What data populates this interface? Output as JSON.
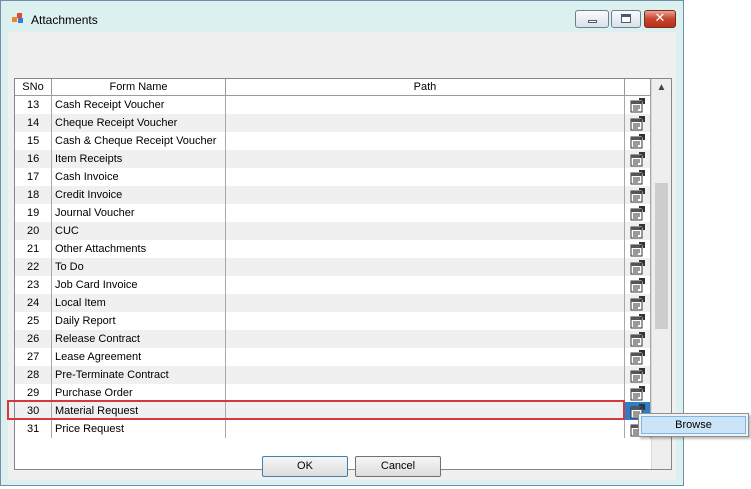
{
  "window": {
    "title": "Attachments",
    "close_glyph": "✕"
  },
  "grid": {
    "columns": [
      "SNo",
      "Form Name",
      "Path",
      ""
    ],
    "rows": [
      {
        "sno": "13",
        "form": "Cash Receipt Voucher",
        "path": ""
      },
      {
        "sno": "14",
        "form": "Cheque Receipt Voucher",
        "path": ""
      },
      {
        "sno": "15",
        "form": "Cash & Cheque Receipt Voucher",
        "path": ""
      },
      {
        "sno": "16",
        "form": "Item Receipts",
        "path": ""
      },
      {
        "sno": "17",
        "form": "Cash Invoice",
        "path": ""
      },
      {
        "sno": "18",
        "form": "Credit Invoice",
        "path": ""
      },
      {
        "sno": "19",
        "form": "Journal Voucher",
        "path": ""
      },
      {
        "sno": "20",
        "form": "CUC",
        "path": ""
      },
      {
        "sno": "21",
        "form": "Other Attachments",
        "path": ""
      },
      {
        "sno": "22",
        "form": "To Do",
        "path": ""
      },
      {
        "sno": "23",
        "form": "Job Card Invoice",
        "path": ""
      },
      {
        "sno": "24",
        "form": "Local Item",
        "path": ""
      },
      {
        "sno": "25",
        "form": "Daily Report",
        "path": ""
      },
      {
        "sno": "26",
        "form": "Release Contract",
        "path": ""
      },
      {
        "sno": "27",
        "form": "Lease Agreement",
        "path": ""
      },
      {
        "sno": "28",
        "form": "Pre-Terminate Contract",
        "path": ""
      },
      {
        "sno": "29",
        "form": "Purchase Order",
        "path": ""
      },
      {
        "sno": "30",
        "form": "Material Request",
        "path": ""
      },
      {
        "sno": "31",
        "form": "Price Request",
        "path": ""
      }
    ],
    "selected_sno": "30",
    "row_icon": "attach-file-icon"
  },
  "context_menu": {
    "items": [
      "Browse"
    ]
  },
  "buttons": {
    "ok": "OK",
    "cancel": "Cancel"
  },
  "colors": {
    "highlight": "#d23b3b",
    "selection": "#2f7cc9",
    "window_bg": "#dcf0f0"
  }
}
